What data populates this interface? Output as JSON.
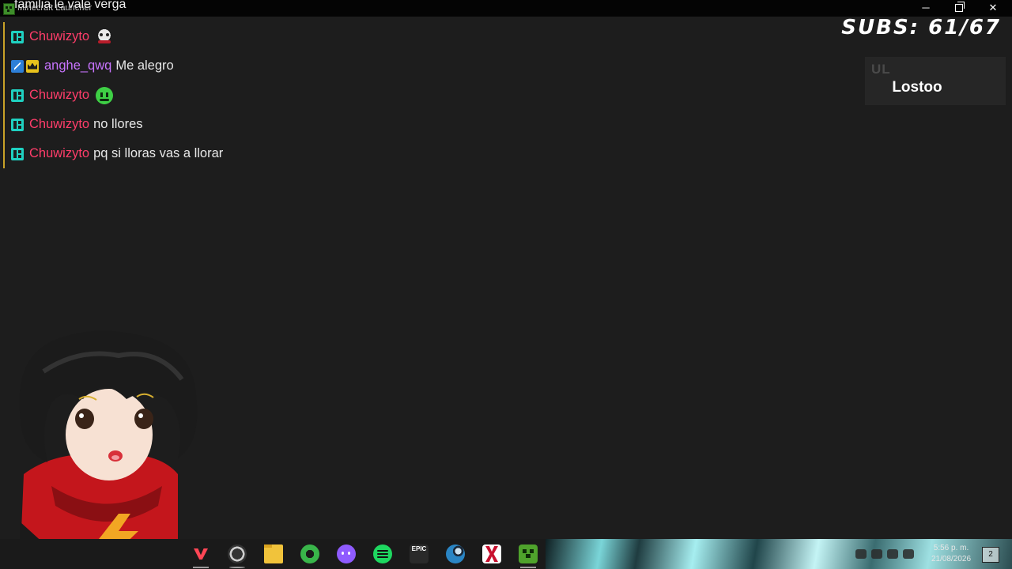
{
  "window": {
    "app_title": "Minecraft Launcher",
    "overlay_text": "familia le vale verga",
    "minimize": "─",
    "close": "✕"
  },
  "chat": {
    "messages": [
      {
        "user": "Chuwizyto",
        "text": "",
        "emote": "skull-emote"
      },
      {
        "user": "anghe_qwq",
        "text": "Me alegro",
        "emote": ""
      },
      {
        "user": "Chuwizyto",
        "text": "",
        "emote": "green-face-emote"
      },
      {
        "user": "Chuwizyto",
        "text": "no llores",
        "emote": ""
      },
      {
        "user": "Chuwizyto",
        "text": "pq si lloras vas a llorar",
        "emote": ""
      }
    ]
  },
  "subs": {
    "label": "SUBS:",
    "count": "61/67"
  },
  "latest": {
    "label": "UL",
    "name": "Lostoo"
  },
  "taskbar": {
    "epic_label": "EPIC",
    "clock_time": "5:56 p. m.",
    "clock_date": "21/08/2026",
    "notification_count": "2",
    "icons": [
      "valorant-icon",
      "obs-icon",
      "file-explorer-icon",
      "xbox-icon",
      "discord-icon",
      "spotify-icon",
      "epic-games-icon",
      "steam-icon",
      "x-app-icon",
      "minecraft-icon"
    ]
  },
  "colors": {
    "background": "#1d1d1d",
    "username_red": "#ff3d6a",
    "username_purple": "#c874ff",
    "chat_border": "#c9a227"
  }
}
